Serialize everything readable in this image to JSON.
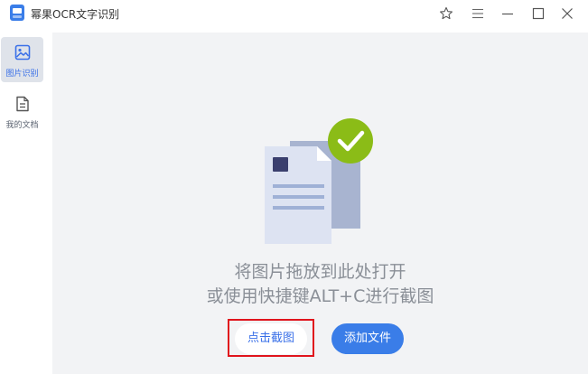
{
  "app": {
    "title": "幂果OCR文字识别",
    "logo_icon": "ocr-logo-icon",
    "accent_color": "#3a7de8"
  },
  "window_controls": {
    "icons": [
      "star-icon",
      "menu-icon",
      "minimize-icon",
      "maximize-icon",
      "close-icon"
    ]
  },
  "sidebar": {
    "items": [
      {
        "label": "图片识别",
        "icon": "image-icon",
        "active": true
      },
      {
        "label": "我的文档",
        "icon": "document-icon",
        "active": false
      }
    ]
  },
  "main": {
    "drop_text": "将图片拖放到此处打开",
    "shortcut_text": "或使用快捷键ALT+C进行截图",
    "capture_button": "点击截图",
    "add_file_button": "添加文件",
    "highlight_color": "#e0141c"
  }
}
